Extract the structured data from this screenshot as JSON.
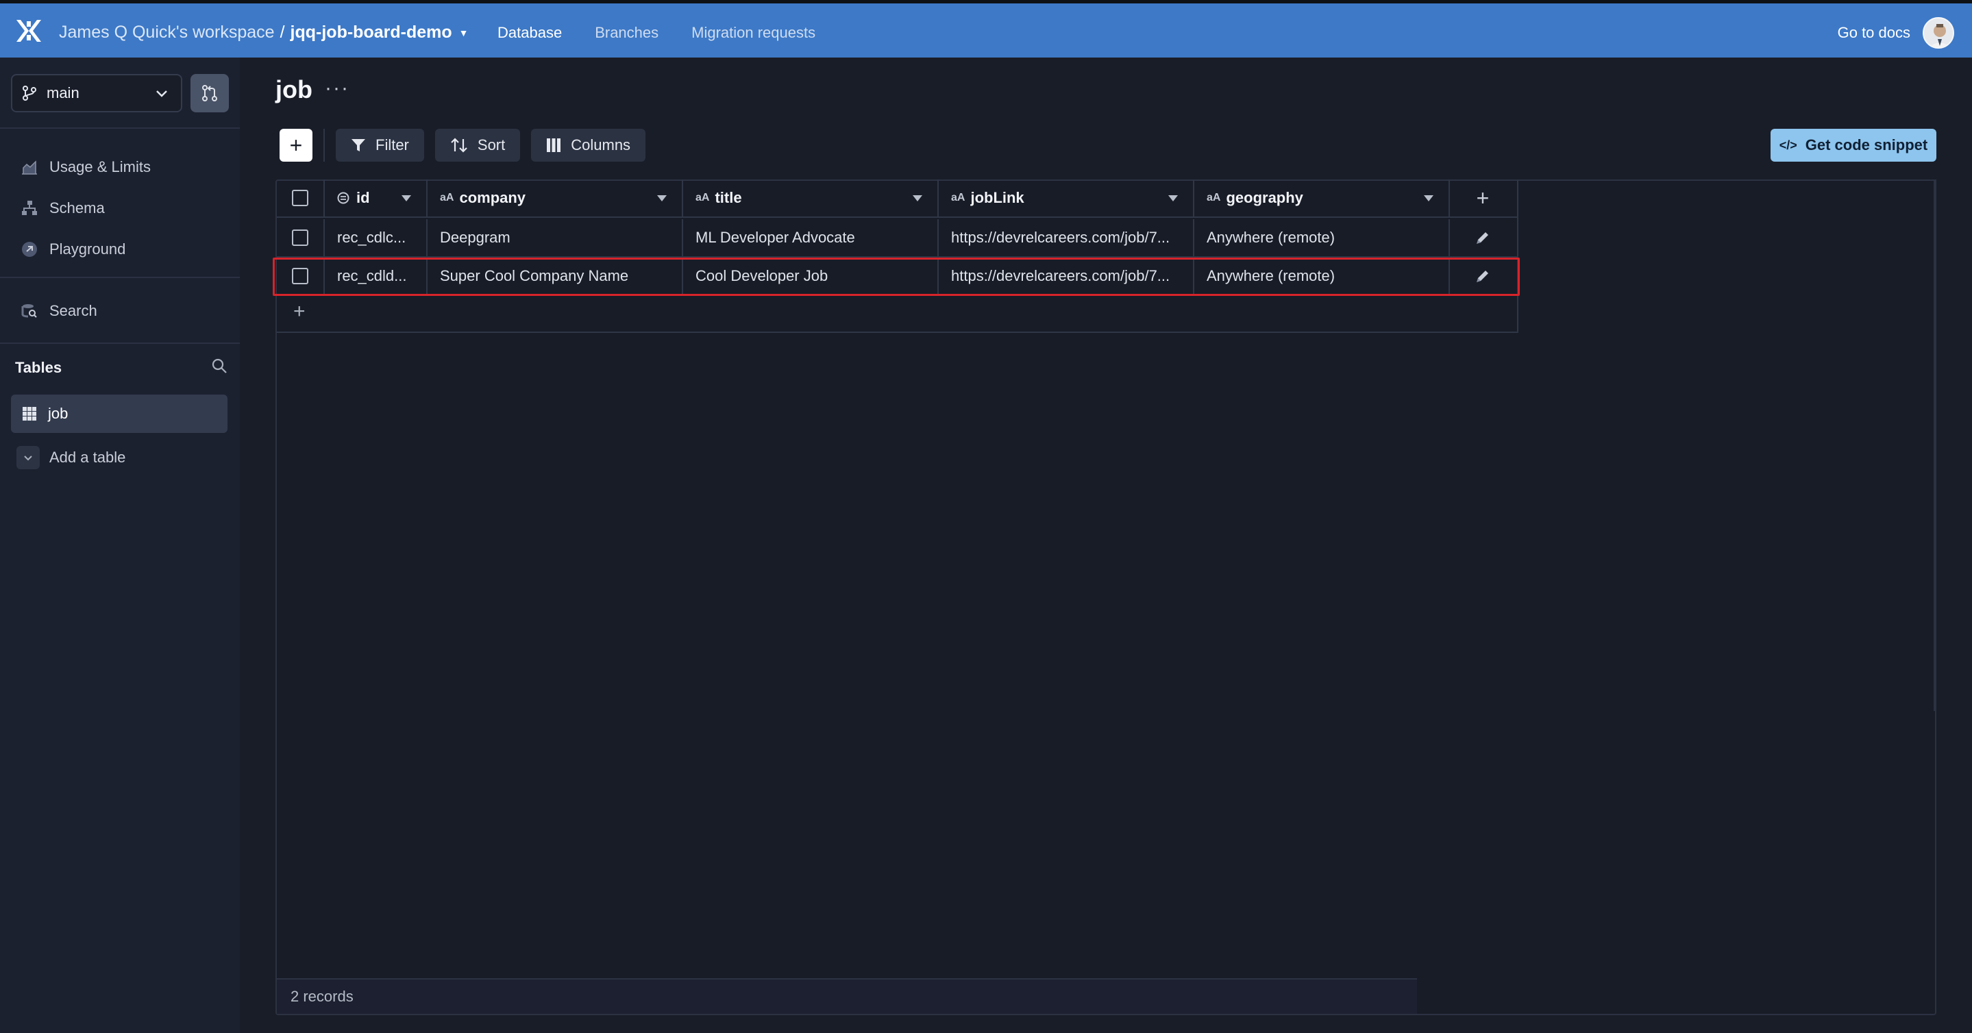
{
  "topbar": {
    "workspace": "James Q Quick's workspace",
    "separator": "/",
    "database": "jqq-job-board-demo",
    "nav": [
      "Database",
      "Branches",
      "Migration requests"
    ],
    "docs_label": "Go to docs"
  },
  "sidebar": {
    "branch": "main",
    "nav_items": [
      {
        "label": "Usage & Limits",
        "icon": "chart-icon"
      },
      {
        "label": "Schema",
        "icon": "schema-icon"
      },
      {
        "label": "Playground",
        "icon": "playground-icon"
      }
    ],
    "search_label": "Search",
    "tables_heading": "Tables",
    "tables": [
      "job"
    ],
    "add_table_label": "Add a table"
  },
  "main": {
    "title": "job",
    "more": "···",
    "toolbar": {
      "add": "+",
      "filter": "Filter",
      "sort": "Sort",
      "columns": "Columns",
      "snippet": "Get code snippet",
      "snippet_code_icon": "</>"
    },
    "table": {
      "type_marker": "aA",
      "columns": [
        "id",
        "company",
        "title",
        "jobLink",
        "geography"
      ],
      "add_column": "+",
      "rows": [
        {
          "id": "rec_cdlc...",
          "company": "Deepgram",
          "title": "ML Developer Advocate",
          "jobLink": "https://devrelcareers.com/job/7...",
          "geography": "Anywhere (remote)"
        },
        {
          "id": "rec_cdld...",
          "company": "Super Cool Company Name",
          "title": "Cool Developer Job",
          "jobLink": "https://devrelcareers.com/job/7...",
          "geography": "Anywhere (remote)"
        }
      ],
      "add_row": "+",
      "highlighted_row": 2,
      "highlight_color": "#d6242a"
    },
    "footer": "2 records"
  },
  "colors": {
    "topbar": "#3d79c7",
    "background": "#191d28",
    "sidebar": "#1c2130",
    "snippet_button": "#8dc5ee"
  }
}
